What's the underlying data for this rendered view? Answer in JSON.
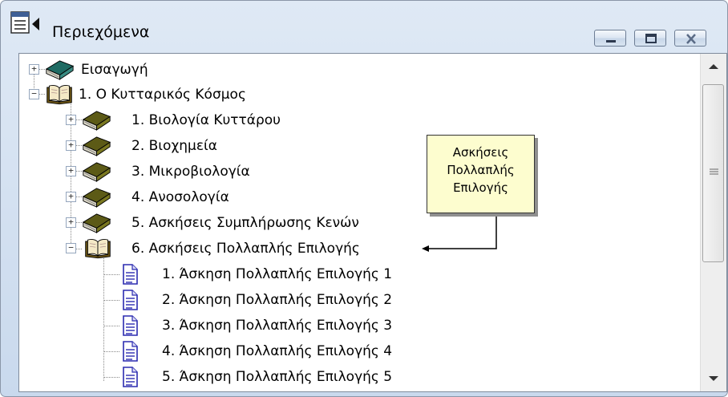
{
  "window": {
    "title": "Περιεχόμενα",
    "icons": {
      "app": "contents-list-icon",
      "minimize": "minimize-icon",
      "maximize": "maximize-icon",
      "close": "close-icon"
    }
  },
  "tree": {
    "nodes": [
      {
        "label": "Εισαγωγή",
        "icon": "closed-book-icon",
        "expander": "+"
      },
      {
        "label": "1.  Ο Κυτταρικός Κόσμος",
        "icon": "open-book-icon",
        "expander": "−"
      },
      {
        "label": "1.  Βιολογία Κυττάρου",
        "icon": "closed-book-icon",
        "expander": "+"
      },
      {
        "label": "2.  Βιοχημεία",
        "icon": "closed-book-icon",
        "expander": "+"
      },
      {
        "label": "3.  Μικροβιολογία",
        "icon": "closed-book-icon",
        "expander": "+"
      },
      {
        "label": "4.  Ανοσολογία",
        "icon": "closed-book-icon",
        "expander": "+"
      },
      {
        "label": "5.  Ασκήσεις Συμπλήρωσης Κενών",
        "icon": "closed-book-icon",
        "expander": "+"
      },
      {
        "label": "6.  Ασκήσεις Πολλαπλής Επιλογής",
        "icon": "open-book-icon",
        "expander": "−"
      },
      {
        "label": "1.  Άσκηση Πολλαπλής Επιλογής 1",
        "icon": "document-icon"
      },
      {
        "label": "2.  Άσκηση Πολλαπλής Επιλογής 2",
        "icon": "document-icon"
      },
      {
        "label": "3.  Άσκηση Πολλαπλής Επιλογής 3",
        "icon": "document-icon"
      },
      {
        "label": "4.  Άσκηση Πολλαπλής Επιλογής 4",
        "icon": "document-icon"
      },
      {
        "label": "5.  Άσκηση Πολλαπλής Επιλογής 5",
        "icon": "document-icon"
      }
    ]
  },
  "callout": {
    "lines": [
      "Ασκήσεις",
      "Πολλαπλής",
      "Επιλογής"
    ]
  },
  "scrollbar": {
    "icons": {
      "up": "scroll-up-arrow-icon",
      "down": "scroll-down-arrow-icon",
      "grip": "scroll-grip-icon"
    }
  },
  "colors": {
    "title_bar": "#dfe9f5",
    "callout_background": "#fdfdcf",
    "closed_book": "#2f7a71",
    "open_book": "#b98a2a",
    "document": "#3c3cb4"
  }
}
